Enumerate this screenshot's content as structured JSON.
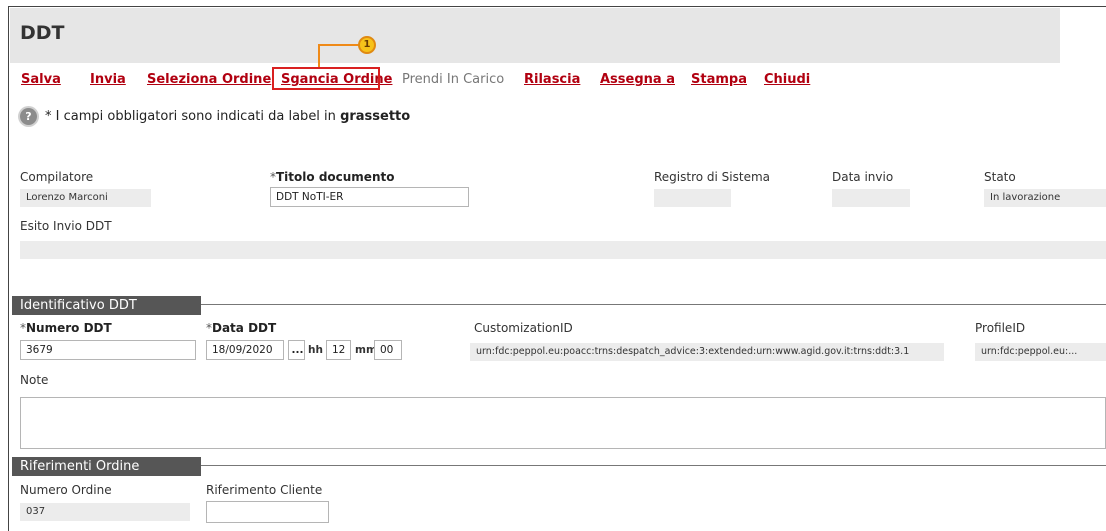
{
  "title": "DDT",
  "toolbar": {
    "salva": "Salva",
    "invia": "Invia",
    "seleziona_ordine": "Seleziona Ordine",
    "sgancia_ordine": "Sgancia Ordine",
    "prendi_in_carico": "Prendi In Carico",
    "rilascia": "Rilascia",
    "assegna_a": "Assegna a",
    "stampa": "Stampa",
    "chiudi": "Chiudi"
  },
  "callout": {
    "number": "1",
    "color": "#ef8a18"
  },
  "info": {
    "icon": "help-icon",
    "prefix": "* I campi obbligatori sono indicati da label in",
    "bold": "grassetto"
  },
  "header_fields": {
    "compilatore_label": "Compilatore",
    "compilatore_value": "Lorenzo Marconi",
    "titolo_req": "*",
    "titolo_label": "Titolo documento",
    "titolo_value": "DDT NoTI-ER",
    "registro_label": "Registro di Sistema",
    "registro_value": "",
    "data_invio_label": "Data invio",
    "data_invio_value": "",
    "stato_label": "Stato",
    "stato_value": "In lavorazione",
    "esito_label": "Esito Invio DDT",
    "esito_value": ""
  },
  "identificativo": {
    "section_title": "Identificativo DDT",
    "numero_req": "*",
    "numero_label": "Numero DDT",
    "numero_value": "3679",
    "data_req": "*",
    "data_label": "Data DDT",
    "data_value": "18/09/2020",
    "calendar_button": "...",
    "hh_label": "hh",
    "hh_value": "12",
    "mm_label": "mm",
    "mm_value": "00",
    "customization_label": "CustomizationID",
    "customization_value": "urn:fdc:peppol.eu:poacc:trns:despatch_advice:3:extended:urn:www.agid.gov.it:trns:ddt:3.1",
    "profile_label": "ProfileID",
    "profile_value": "urn:fdc:peppol.eu:...",
    "note_label": "Note"
  },
  "riferimenti": {
    "section_title": "Riferimenti Ordine",
    "numero_ordine_label": "Numero Ordine",
    "numero_ordine_value": "037",
    "riferimento_cliente_label": "Riferimento Cliente",
    "riferimento_cliente_value": ""
  }
}
